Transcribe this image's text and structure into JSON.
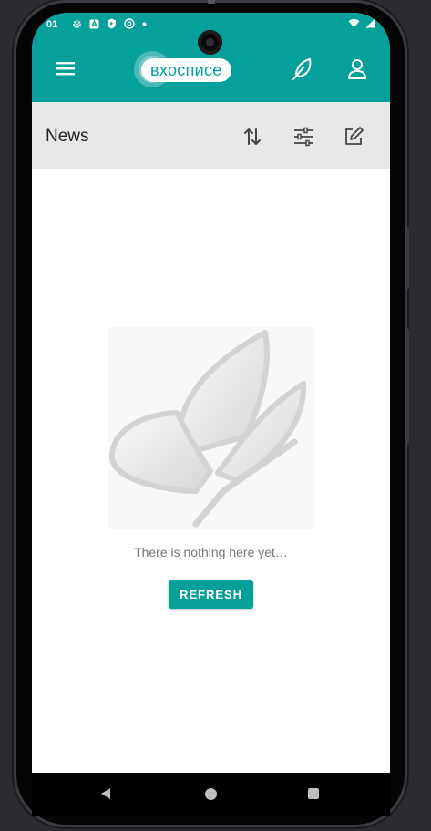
{
  "status_bar": {
    "time": "01"
  },
  "app_bar": {
    "logo_text": "вхосписе",
    "brand_color": "#06a09a",
    "icons": [
      "menu-icon",
      "feather-icon",
      "profile-icon"
    ]
  },
  "toolbar": {
    "title": "News",
    "icons": [
      "sort-icon",
      "filter-icon",
      "edit-icon"
    ]
  },
  "empty_state": {
    "message": "There is nothing here yet…",
    "refresh_label": "REFRESH"
  },
  "navigation": {
    "icons": [
      "back-icon",
      "home-icon",
      "recents-icon"
    ]
  }
}
